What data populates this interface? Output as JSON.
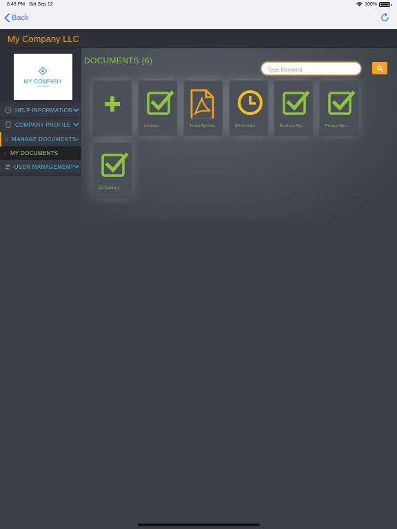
{
  "status_bar": {
    "time": "8:49 PM",
    "date": "Sat Sep 12",
    "battery": "100%"
  },
  "nav": {
    "back_label": "Back"
  },
  "header": {
    "title": "My Company LLC"
  },
  "logo": {
    "name": "MY COMPANY",
    "slogan": "your slogan"
  },
  "sidebar": {
    "items": [
      {
        "label": "HELP INFORMATION"
      },
      {
        "label": "COMPANY PROFILE"
      },
      {
        "label": "MANAGE DOCUMENTS"
      },
      {
        "label": "USER MANAGEMENT"
      }
    ],
    "submenu": {
      "label": "MY DOCUMENTS"
    }
  },
  "main": {
    "title": "DOCUMENTS (6)",
    "search_placeholder": "Type Keyword",
    "documents": [
      {
        "label": "Contract",
        "icon": "check-icon"
      },
      {
        "label": "Terms Agreem..",
        "icon": "pdf-icon"
      },
      {
        "label": "DJ Contract ..",
        "icon": "clock-icon"
      },
      {
        "label": "Business Agr..",
        "icon": "check-icon"
      },
      {
        "label": "Privacy Agre..",
        "icon": "check-icon"
      },
      {
        "label": "DJ Contract",
        "icon": "check-icon"
      }
    ]
  },
  "colors": {
    "accent_orange": "#f3a21d",
    "accent_green": "#8cc63f",
    "link_blue": "#5fb6dd",
    "background": "#3b3f47"
  }
}
